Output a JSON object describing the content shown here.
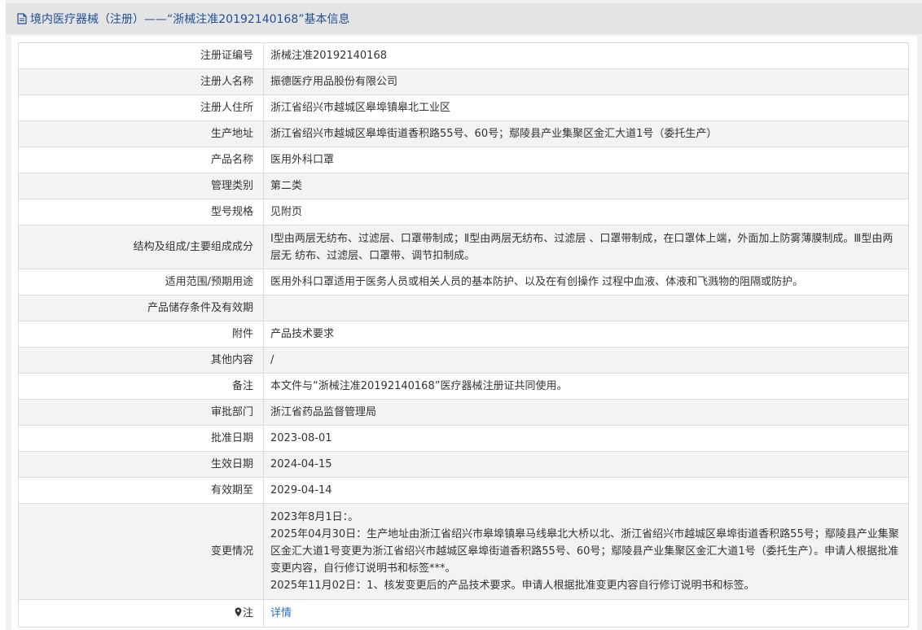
{
  "header": {
    "title": "境内医疗器械（注册）——“浙械注准20192140168”基本信息"
  },
  "rows": [
    {
      "label": "注册证编号",
      "value": "浙械注准20192140168"
    },
    {
      "label": "注册人名称",
      "value": "振德医疗用品股份有限公司"
    },
    {
      "label": "注册人住所",
      "value": "浙江省绍兴市越城区皋埠镇皋北工业区"
    },
    {
      "label": "生产地址",
      "value": "浙江省绍兴市越城区皋埠街道香积路55号、60号；鄢陵县产业集聚区金汇大道1号（委托生产）"
    },
    {
      "label": "产品名称",
      "value": "医用外科口罩"
    },
    {
      "label": "管理类别",
      "value": "第二类"
    },
    {
      "label": "型号规格",
      "value": "见附页"
    },
    {
      "label": "结构及组成/主要组成成分",
      "value": "Ⅰ型由两层无纺布、过滤层、口罩带制成；Ⅱ型由两层无纺布、过滤层 、口罩带制成，在口罩体上端，外面加上防雾薄膜制成。Ⅲ型由两层无 纺布、过滤层、口罩带、调节扣制成。"
    },
    {
      "label": "适用范围/预期用途",
      "value": "医用外科口罩适用于医务人员或相关人员的基本防护、以及在有创操作 过程中血液、体液和飞溅物的阻隔或防护。"
    },
    {
      "label": "产品储存条件及有效期",
      "value": ""
    },
    {
      "label": "附件",
      "value": "产品技术要求"
    },
    {
      "label": "其他内容",
      "value": "/"
    },
    {
      "label": "备注",
      "value": "本文件与“浙械注准20192140168”医疗器械注册证共同使用。"
    },
    {
      "label": "审批部门",
      "value": "浙江省药品监督管理局"
    },
    {
      "label": "批准日期",
      "value": "2023-08-01"
    },
    {
      "label": "生效日期",
      "value": "2024-04-15"
    },
    {
      "label": "有效期至",
      "value": "2029-04-14"
    }
  ],
  "change": {
    "label": "变更情况",
    "lines": [
      "2023年8月1日：。",
      "2025年04月30日：生产地址由浙江省绍兴市皋埠镇皋马线皋北大桥以北、浙江省绍兴市越城区皋埠街道香积路55号；鄢陵县产业集聚区金汇大道1号变更为浙江省绍兴市越城区皋埠街道香积路55号、60号；鄢陵县产业集聚区金汇大道1号（委托生产）。申请人根据批准变更内容，自行修订说明书和标签***。",
      "2025年11月02日：1、核发变更后的产品技术要求。申请人根据批准变更内容自行修订说明书和标签。"
    ]
  },
  "note": {
    "label": "注",
    "link": "详情"
  }
}
